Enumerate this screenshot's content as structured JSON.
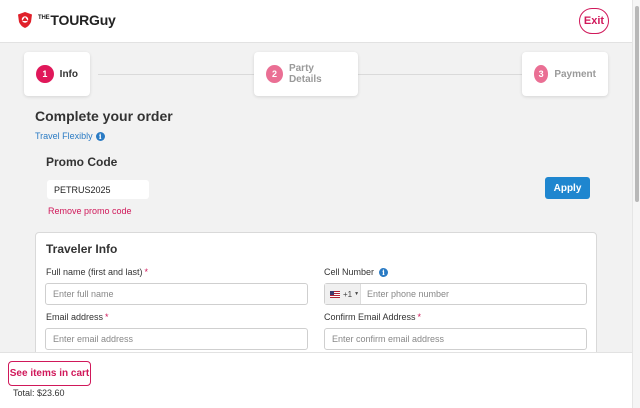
{
  "header": {
    "logo_the": "THE",
    "logo_name": "TOURGuy",
    "exit_label": "Exit"
  },
  "stepper": [
    {
      "number": "1",
      "label": "Info",
      "state": "active"
    },
    {
      "number": "2",
      "label": "Party Details",
      "state": "inactive"
    },
    {
      "number": "3",
      "label": "Payment",
      "state": "inactive"
    }
  ],
  "main": {
    "title": "Complete your order",
    "travel_flexibly": "Travel Flexibly",
    "promo": {
      "title": "Promo Code",
      "value": "PETRUS2025",
      "apply_label": "Apply",
      "remove_label": "Remove promo code"
    },
    "traveler": {
      "title": "Traveler Info",
      "full_name_label": "Full name (first and last)",
      "full_name_placeholder": "Enter full name",
      "cell_label": "Cell Number",
      "country_code": "+1",
      "phone_placeholder": "Enter phone number",
      "email_label": "Email address",
      "email_placeholder": "Enter email address",
      "confirm_email_label": "Confirm Email Address",
      "confirm_email_placeholder": "Enter confirm email address",
      "required_mark": "*"
    }
  },
  "footer": {
    "see_items_label": "See items in cart",
    "total_text": "Total: $23.60"
  },
  "colors": {
    "brand_pink": "#d0185a",
    "link_blue": "#2a7bc4",
    "apply_blue": "#1f86cf"
  }
}
